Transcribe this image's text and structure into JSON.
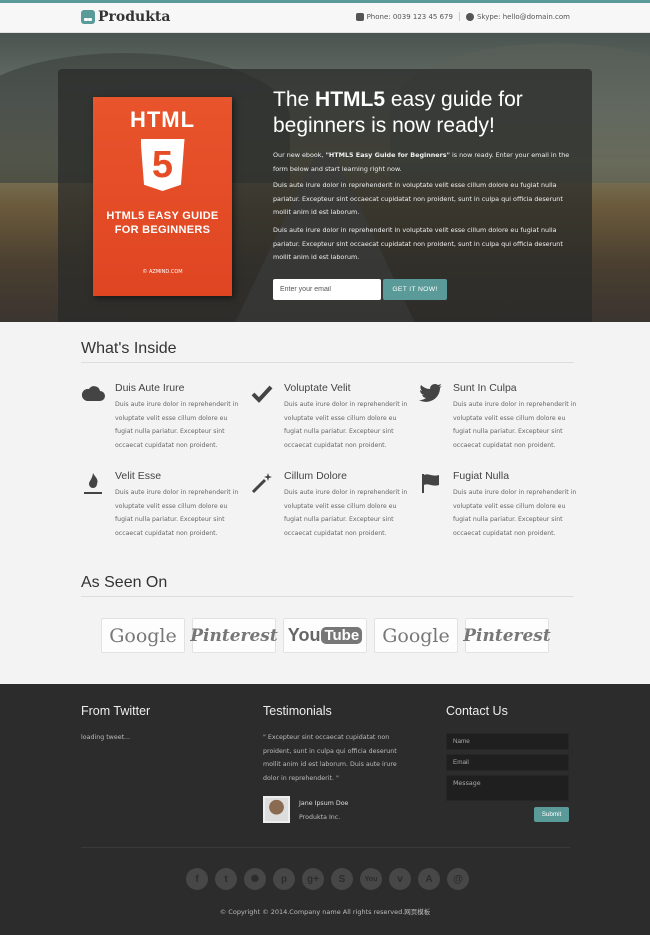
{
  "header": {
    "logo_text": "Produkta",
    "phone": "Phone: 0039 123 45 679",
    "skype": "Skype: hello@domain.com"
  },
  "hero": {
    "book": {
      "top": "HTML",
      "number": "5",
      "title_line1": "HTML5 EASY GUIDE",
      "title_line2": "FOR BEGINNERS",
      "publisher": "© AZMIND.COM"
    },
    "title_pre": "The ",
    "title_bold": "HTML5",
    "title_post": " easy guide for beginners is now ready!",
    "intro_pre": "Our new ebook, ",
    "intro_bold": "\"HTML5 Easy Guide for Beginners\"",
    "intro_post": " is now ready. Enter your email in the form below and start learning right now.",
    "para1": "Duis aute irure dolor in reprehenderit in voluptate velit esse cillum dolore eu fugiat nulla pariatur. Excepteur sint occaecat cupidatat non proident, sunt in culpa qui officia deserunt mollit anim id est laborum.",
    "para2": "Duis aute irure dolor in reprehenderit in voluptate velit esse cillum dolore eu fugiat nulla pariatur. Excepteur sint occaecat cupidatat non proident, sunt in culpa qui officia deserunt mollit anim id est laborum.",
    "email_placeholder": "Enter your email",
    "cta_label": "GET IT NOW!"
  },
  "inside": {
    "title": "What's Inside",
    "features": [
      {
        "icon": "cloud-icon",
        "title": "Duis Aute Irure",
        "text": "Duis aute irure dolor in reprehenderit in voluptate velit esse cillum dolore eu fugiat nulla pariatur. Excepteur sint occaecat cupidatat non proident."
      },
      {
        "icon": "checkmark-icon",
        "title": "Voluptate Velit",
        "text": "Duis aute irure dolor in reprehenderit in voluptate velit esse cillum dolore eu fugiat nulla pariatur. Excepteur sint occaecat cupidatat non proident."
      },
      {
        "icon": "twitter-bird-icon",
        "title": "Sunt In Culpa",
        "text": "Duis aute irure dolor in reprehenderit in voluptate velit esse cillum dolore eu fugiat nulla pariatur. Excepteur sint occaecat cupidatat non proident."
      },
      {
        "icon": "flame-icon",
        "title": "Velit Esse",
        "text": "Duis aute irure dolor in reprehenderit in voluptate velit esse cillum dolore eu fugiat nulla pariatur. Excepteur sint occaecat cupidatat non proident."
      },
      {
        "icon": "magic-wand-icon",
        "title": "Cillum Dolore",
        "text": "Duis aute irure dolor in reprehenderit in voluptate velit esse cillum dolore eu fugiat nulla pariatur. Excepteur sint occaecat cupidatat non proident."
      },
      {
        "icon": "flag-icon",
        "title": "Fugiat Nulla",
        "text": "Duis aute irure dolor in reprehenderit in voluptate velit esse cillum dolore eu fugiat nulla pariatur. Excepteur sint occaecat cupidatat non proident."
      }
    ]
  },
  "seen_on": {
    "title": "As Seen On",
    "logos": [
      "Google",
      "Pinterest",
      "YouTube",
      "Google",
      "Pinterest"
    ],
    "yt_you": "You",
    "yt_tube": "Tube"
  },
  "footer": {
    "twitter_title": "From Twitter",
    "twitter_loading": "loading tweet...",
    "testimonials_title": "Testimonials",
    "testimonial_text": "\" Excepteur sint occaecat cupidatat non proident, sunt in culpa qui officia deserunt mollit anim id est laborum. Duis aute irure dolor in reprehenderit. \"",
    "testimonial_name": "Jane Ipsum Doe",
    "testimonial_company": "Produkta Inc.",
    "contact_title": "Contact Us",
    "name_placeholder": "Name",
    "email_placeholder": "Email",
    "message_placeholder": "Message",
    "submit_label": "Submit",
    "social": [
      "facebook-icon",
      "twitter-icon",
      "dribbble-icon",
      "pinterest-icon",
      "googleplus-icon",
      "skype-icon",
      "youtube-icon",
      "vimeo-icon",
      "appstore-icon",
      "email-icon"
    ],
    "social_glyphs": [
      "f",
      "t",
      "✺",
      "p",
      "g+",
      "S",
      "You",
      "v",
      "A",
      "@"
    ],
    "copyright": "© Copyright © 2014.Company name All rights reserved.网页模板"
  },
  "colors": {
    "accent": "#5a9a98",
    "footer_bg": "#2c2c2c",
    "book": "#e44d26"
  }
}
